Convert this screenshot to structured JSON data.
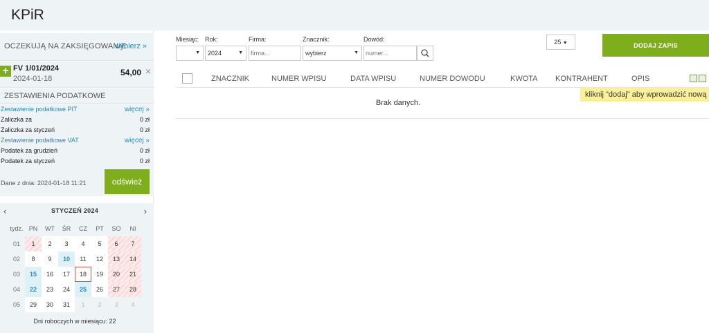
{
  "app": {
    "title": "KPiR"
  },
  "pending": {
    "title": "OCZEKUJĄ NA ZAKSIĘGOWANIE",
    "choose_label": "wybierz »",
    "items": [
      {
        "add_icon": "+",
        "name": "FV 1/01/2024",
        "date": "2024-01-18",
        "amount": "54,00",
        "close_icon": "×"
      }
    ]
  },
  "tax": {
    "title": "ZESTAWIENIA PODATKOWE",
    "rows": [
      {
        "label": "Zestawienie podatkowe PIT",
        "value": "więcej »",
        "link": true
      },
      {
        "label": "Zaliczka za",
        "value": "0 zł"
      },
      {
        "label": "Zaliczka za styczeń",
        "value": "0 zł"
      },
      {
        "label": "Zestawienie podatkowe VAT",
        "value": "więcej »",
        "link": true
      },
      {
        "label": "Podatek za grudzień",
        "value": "0 zł"
      },
      {
        "label": "Podatek za styczeń",
        "value": "0 zł"
      }
    ],
    "data_from": "Dane z dnia: 2024-01-18 11:21",
    "refresh_label": "odśwież"
  },
  "calendar": {
    "prev_icon": "‹",
    "next_icon": "›",
    "month_label": "STYCZEŃ 2024",
    "headers": [
      "tydz.",
      "PN",
      "WT",
      "ŚR",
      "CZ",
      "PT",
      "SO",
      "NI"
    ],
    "weeks": [
      {
        "week": "01",
        "days": [
          "1",
          "2",
          "3",
          "4",
          "5",
          "6",
          "7"
        ]
      },
      {
        "week": "02",
        "days": [
          "8",
          "9",
          "10",
          "11",
          "12",
          "13",
          "14"
        ]
      },
      {
        "week": "03",
        "days": [
          "15",
          "16",
          "17",
          "18",
          "19",
          "20",
          "21"
        ]
      },
      {
        "week": "04",
        "days": [
          "22",
          "23",
          "24",
          "25",
          "26",
          "27",
          "28"
        ]
      },
      {
        "week": "05",
        "days": [
          "29",
          "30",
          "31",
          "1",
          "2",
          "3",
          "4"
        ]
      }
    ],
    "footer": "Dni roboczych w miesiącu: 22"
  },
  "filters": {
    "month": {
      "label": "Miesiąc:",
      "value": ""
    },
    "year": {
      "label": "Rok:",
      "value": "2024"
    },
    "company": {
      "label": "Firma:",
      "placeholder": "firma..."
    },
    "tag": {
      "label": "Znacznik:",
      "value": "wybierz"
    },
    "proof": {
      "label": "Dowód:",
      "placeholder": "numer..."
    }
  },
  "page_size": "25",
  "add_button_label": "DODAJ ZAPIS",
  "table": {
    "columns": [
      "ZNACZNIK",
      "NUMER WPISU",
      "DATA WPISU",
      "NUMER DOWODU",
      "KWOTA",
      "KONTRAHENT",
      "OPIS"
    ],
    "empty_text": "Brak danych."
  },
  "tooltip": "kliknij \"dodaj\" aby wprowadzić nową pozycję",
  "colors": {
    "accent_green": "#7fae1c",
    "link_blue": "#2a8ab7",
    "panel_bg": "#eef3f6",
    "tooltip_bg": "#fcf099"
  }
}
